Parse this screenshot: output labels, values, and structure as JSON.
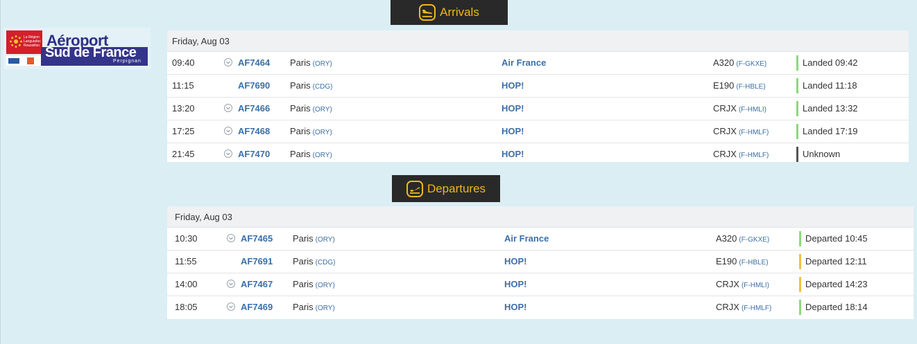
{
  "logo": {
    "region_text": "La Région Languedoc Roussillon",
    "line1": "Aéroport",
    "line2": "Sud de France",
    "line3": "Perpignan"
  },
  "arrivals": {
    "title": "Arrivals",
    "date": "Friday, Aug 03",
    "flights": [
      {
        "time": "09:40",
        "expand": true,
        "flight": "AF7464",
        "city": "Paris",
        "code": "(ORY)",
        "airline": "Air France",
        "aircraft": "A320",
        "reg": "(F-GKXE)",
        "status": "Landed 09:42",
        "status_color": "#8cd97a"
      },
      {
        "time": "11:15",
        "expand": false,
        "flight": "AF7690",
        "city": "Paris",
        "code": "(CDG)",
        "airline": "HOP!",
        "aircraft": "E190",
        "reg": "(F-HBLE)",
        "status": "Landed 11:18",
        "status_color": "#8cd97a"
      },
      {
        "time": "13:20",
        "expand": true,
        "flight": "AF7466",
        "city": "Paris",
        "code": "(ORY)",
        "airline": "HOP!",
        "aircraft": "CRJX",
        "reg": "(F-HMLI)",
        "status": "Landed 13:32",
        "status_color": "#8cd97a"
      },
      {
        "time": "17:25",
        "expand": true,
        "flight": "AF7468",
        "city": "Paris",
        "code": "(ORY)",
        "airline": "HOP!",
        "aircraft": "CRJX",
        "reg": "(F-HMLF)",
        "status": "Landed 17:19",
        "status_color": "#8cd97a"
      },
      {
        "time": "21:45",
        "expand": true,
        "flight": "AF7470",
        "city": "Paris",
        "code": "(ORY)",
        "airline": "HOP!",
        "aircraft": "CRJX",
        "reg": "(F-HMLF)",
        "status": "Unknown",
        "status_color": "#555555"
      }
    ]
  },
  "departures": {
    "title": "Departures",
    "date": "Friday, Aug 03",
    "flights": [
      {
        "time": "10:30",
        "expand": true,
        "flight": "AF7465",
        "city": "Paris",
        "code": "(ORY)",
        "airline": "Air France",
        "aircraft": "A320",
        "reg": "(F-GKXE)",
        "status": "Departed 10:45",
        "status_color": "#8cd97a"
      },
      {
        "time": "11:55",
        "expand": false,
        "flight": "AF7691",
        "city": "Paris",
        "code": "(CDG)",
        "airline": "HOP!",
        "aircraft": "E190",
        "reg": "(F-HBLE)",
        "status": "Departed 12:11",
        "status_color": "#f0c040"
      },
      {
        "time": "14:00",
        "expand": true,
        "flight": "AF7467",
        "city": "Paris",
        "code": "(ORY)",
        "airline": "HOP!",
        "aircraft": "CRJX",
        "reg": "(F-HMLI)",
        "status": "Departed 14:23",
        "status_color": "#f0c040"
      },
      {
        "time": "18:05",
        "expand": true,
        "flight": "AF7469",
        "city": "Paris",
        "code": "(ORY)",
        "airline": "HOP!",
        "aircraft": "CRJX",
        "reg": "(F-HMLF)",
        "status": "Departed 18:14",
        "status_color": "#8cd97a"
      }
    ]
  }
}
